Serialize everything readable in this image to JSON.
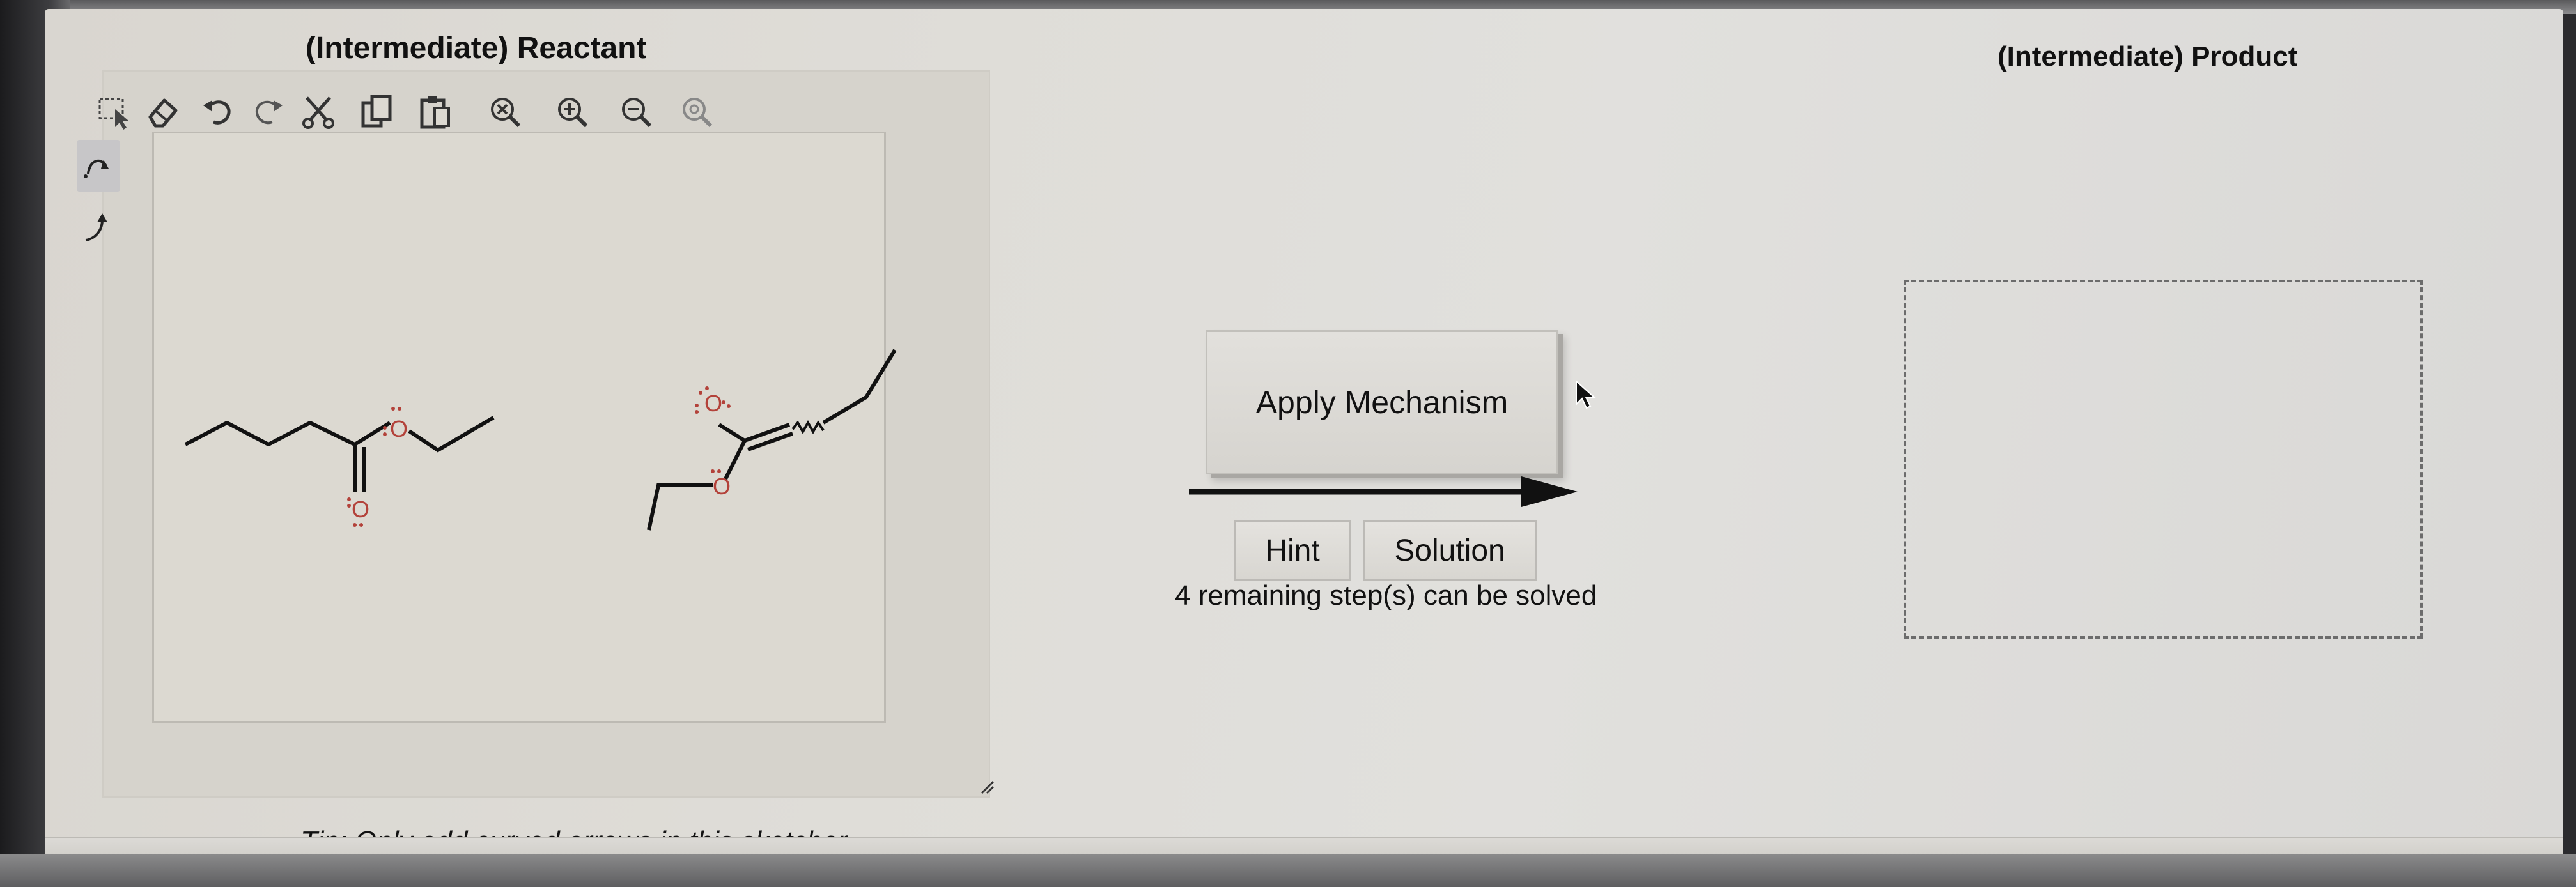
{
  "reactant_panel": {
    "title": "(Intermediate) Reactant",
    "tip": "Tip: Only add curved arrows in this sketcher",
    "toolbar_icons": [
      "select-icon",
      "eraser-icon",
      "undo-icon",
      "redo-icon",
      "cut-icon",
      "copy-icon",
      "paste-icon",
      "clear-icon",
      "zoom-in-icon",
      "zoom-out-icon",
      "zoom-reset-icon"
    ],
    "side_tools": [
      "curved-arrow-pair-icon",
      "curved-arrow-single-icon"
    ],
    "molecules": {
      "ester_atoms": [
        "O",
        "O"
      ],
      "enolate_atoms": [
        "O",
        "O"
      ]
    },
    "colors": {
      "bond": "#111111",
      "oxygen": "#b3423a"
    }
  },
  "mechanism": {
    "apply_label": "Apply Mechanism",
    "hint_label": "Hint",
    "solution_label": "Solution",
    "remaining_text": "4 remaining step(s) can be solved"
  },
  "product_panel": {
    "title": "(Intermediate) Product"
  }
}
